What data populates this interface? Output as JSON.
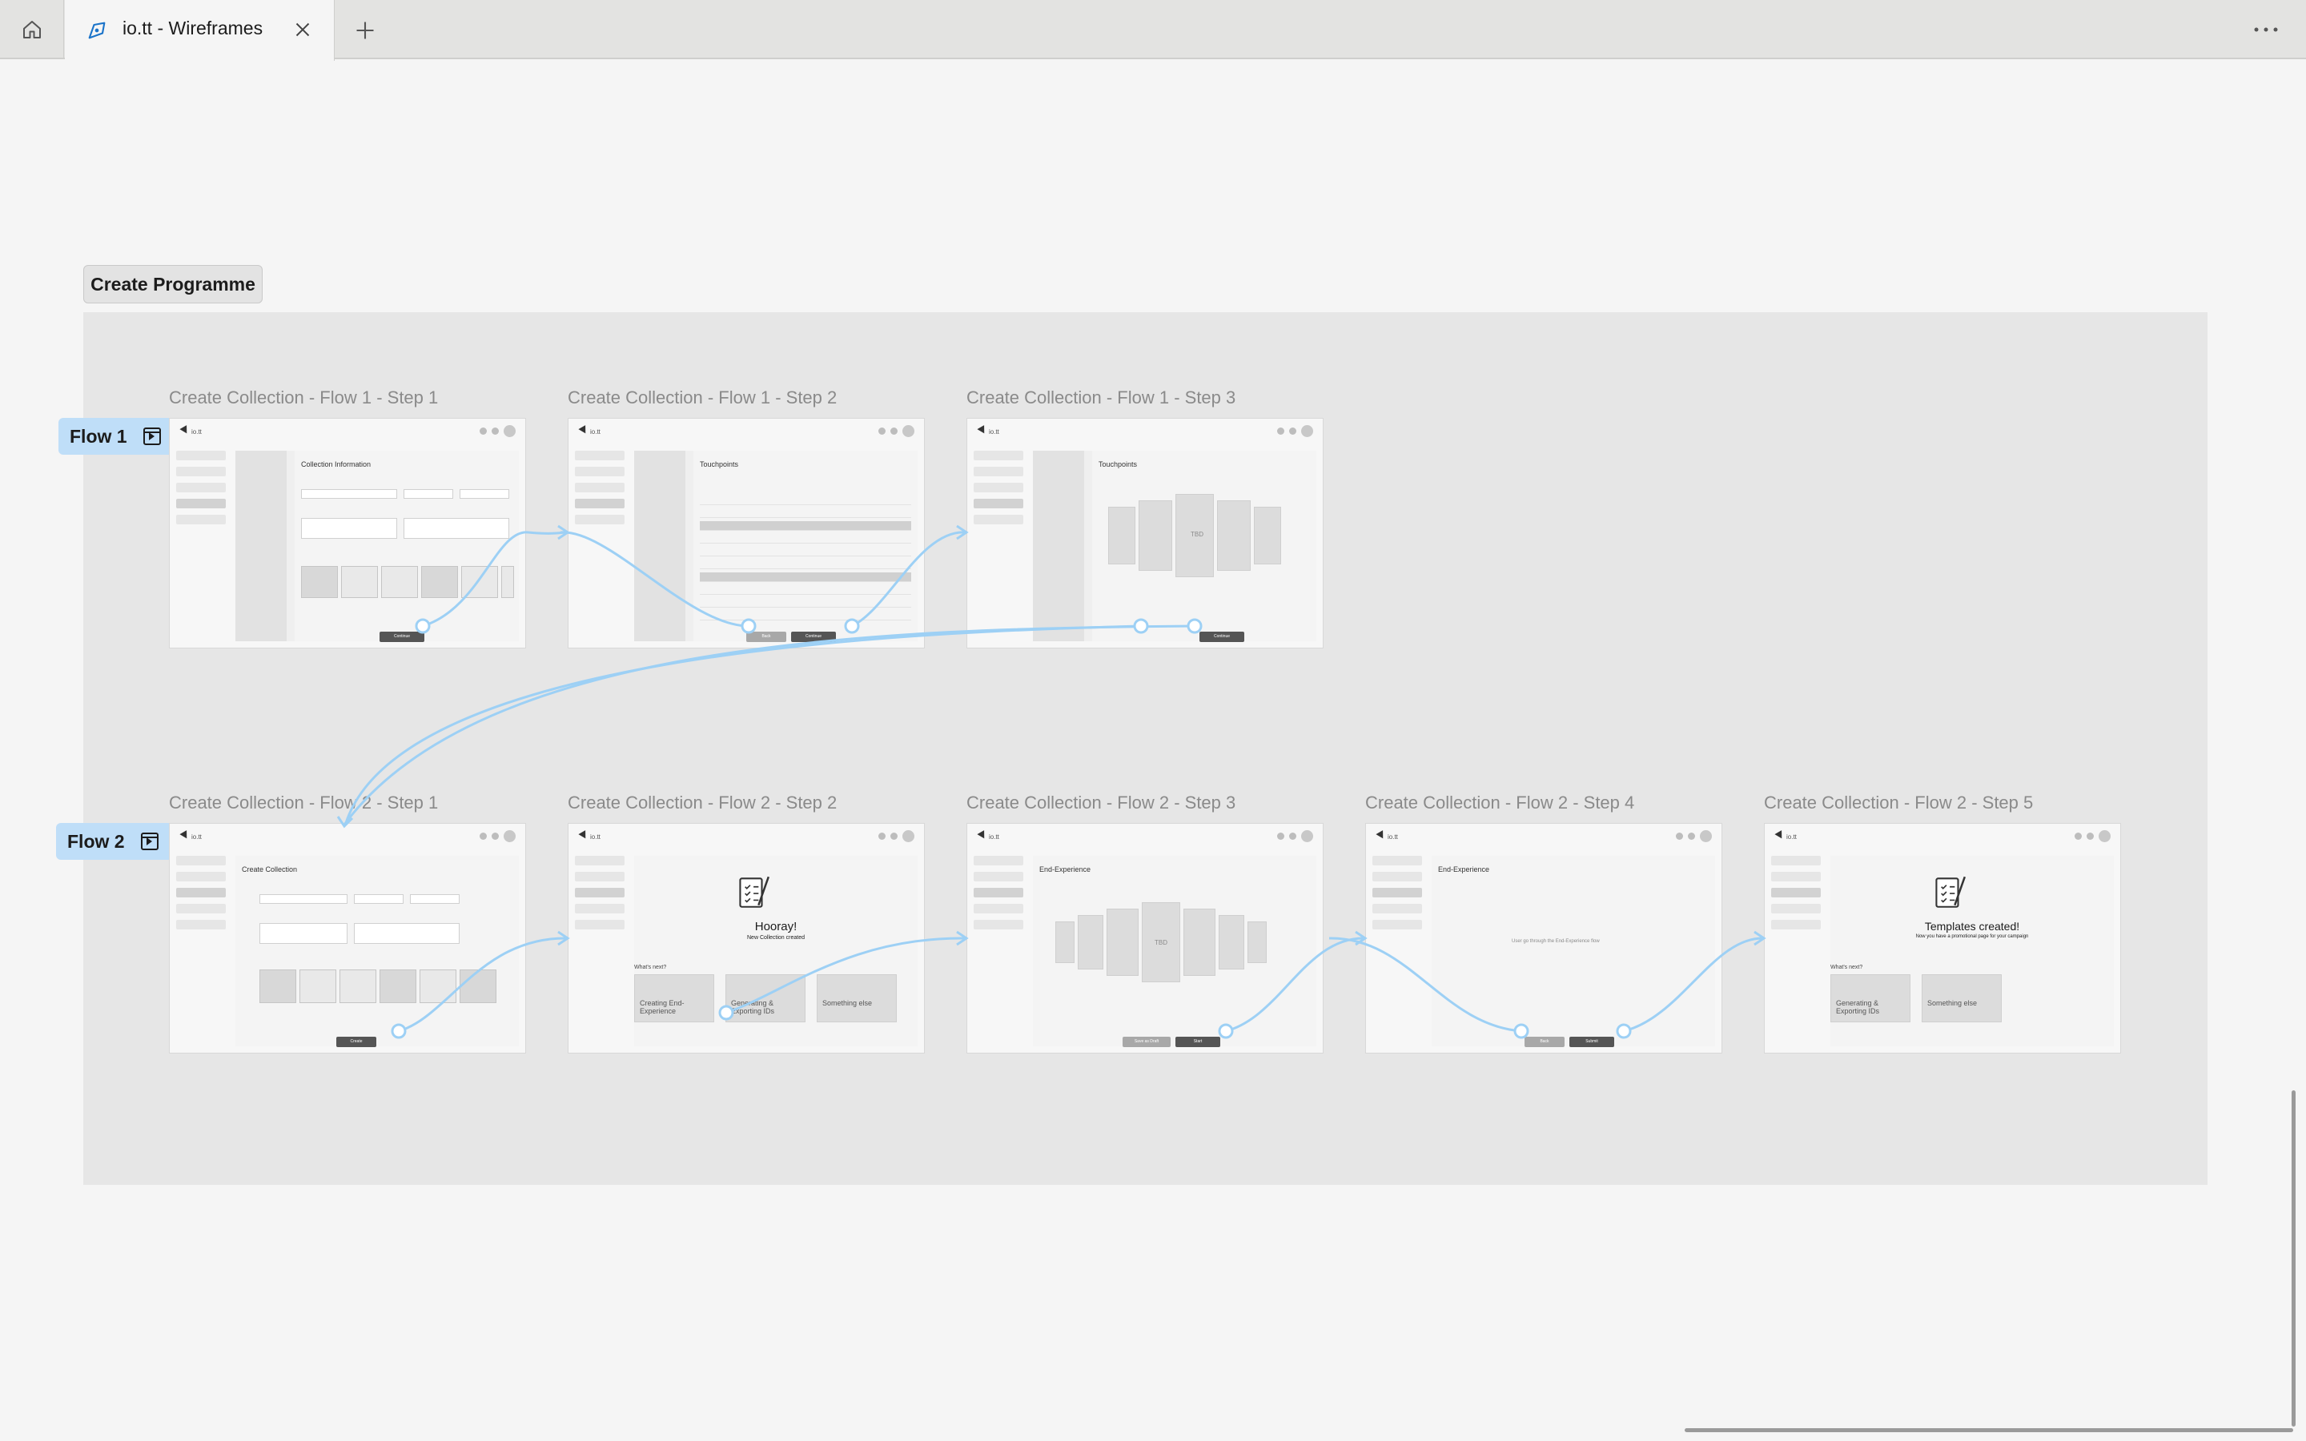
{
  "tabs": {
    "home_icon": "home-icon",
    "active_tab": {
      "label": "io.tt - Wireframes",
      "icon": "figma-pen-icon"
    },
    "add_icon": "plus-icon",
    "more_icon": "ellipsis-icon"
  },
  "canvas": {
    "section_label": "Create Programme",
    "flow_tags": [
      {
        "label": "Flow 1"
      },
      {
        "label": "Flow 2"
      }
    ],
    "frames": [
      {
        "title": "Create Collection - Flow 1 - Step 1",
        "heading": "Collection Information",
        "button": "Continue"
      },
      {
        "title": "Create Collection - Flow 1 - Step 2",
        "heading": "Touchpoints",
        "back": "Back",
        "button": "Continue"
      },
      {
        "title": "Create Collection - Flow 1 - Step 3",
        "heading": "Touchpoints",
        "center": "TBD",
        "button": "Continue"
      },
      {
        "title": "Create Collection - Flow 2 - Step 1",
        "heading": "Create Collection",
        "button": "Create"
      },
      {
        "title": "Create Collection - Flow 2 - Step 2",
        "heading": "Hooray!",
        "sub": "New Collection created",
        "whats_next": "What's next?",
        "cards": [
          "Creating End-Experience",
          "Generating & Exporting IDs",
          "Something else"
        ]
      },
      {
        "title": "Create Collection - Flow 2 - Step 3",
        "heading": "End-Experience",
        "center": "TBD",
        "back": "Save as Draft",
        "button": "Start"
      },
      {
        "title": "Create Collection - Flow 2 - Step 4",
        "heading": "End-Experience",
        "center": "User go through the End-Experience flow",
        "back": "Back",
        "button": "Submit"
      },
      {
        "title": "Create Collection - Flow 2 - Step 5",
        "heading": "Templates created!",
        "sub": "Now you have a promotional page for your campaign",
        "whats_next": "What's next?",
        "cards": [
          "Generating & Exporting IDs",
          "Something else"
        ]
      }
    ]
  }
}
